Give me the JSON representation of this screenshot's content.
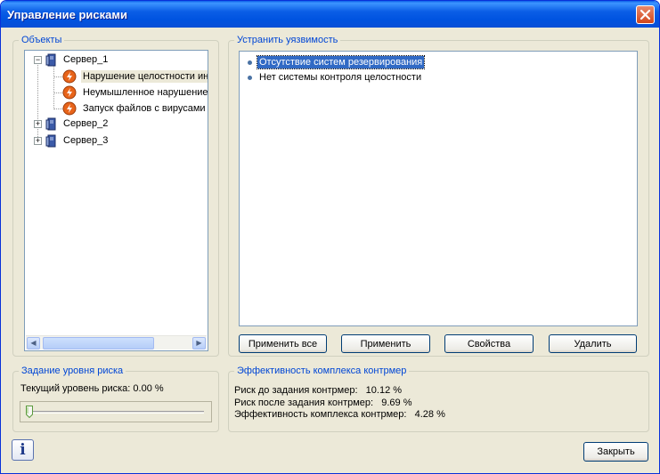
{
  "window": {
    "title": "Управление рисками"
  },
  "objects": {
    "legend": "Объекты",
    "tree": [
      {
        "label": "Сервер_1",
        "expander": "−"
      },
      {
        "label": "Нарушение целостности ин"
      },
      {
        "label": "Неумышленное нарушение"
      },
      {
        "label": "Запуск файлов с вирусами"
      },
      {
        "label": "Сервер_2",
        "expander": "+"
      },
      {
        "label": "Сервер_3",
        "expander": "+"
      }
    ]
  },
  "vulnerabilities": {
    "legend": "Устранить уязвимость",
    "items": [
      {
        "label": "Отсутствие систем резервирования"
      },
      {
        "label": "Нет системы контроля целостности"
      }
    ]
  },
  "buttons": {
    "apply_all": "Применить все",
    "apply": "Применить",
    "properties": "Свойства",
    "delete": "Удалить",
    "close": "Закрыть",
    "info": "i"
  },
  "risk_level": {
    "legend": "Задание уровня риска",
    "label": "Текущий уровень риска: 0.00 %",
    "slider_value": 0
  },
  "efficiency": {
    "legend": "Эффективность комплекса контрмер",
    "lines": [
      "Риск до задания контрмер:   10.12 %",
      "Риск после задания контрмер:   9.69 %",
      "Эффективность комплекса контрмер:   4.28 %"
    ]
  },
  "colors": {
    "title_bar": "#0054e3",
    "legend_text": "#0046d5",
    "selection": "#316ac5",
    "dialog_bg": "#ece9d8",
    "threat_icon": "#e8641a"
  }
}
